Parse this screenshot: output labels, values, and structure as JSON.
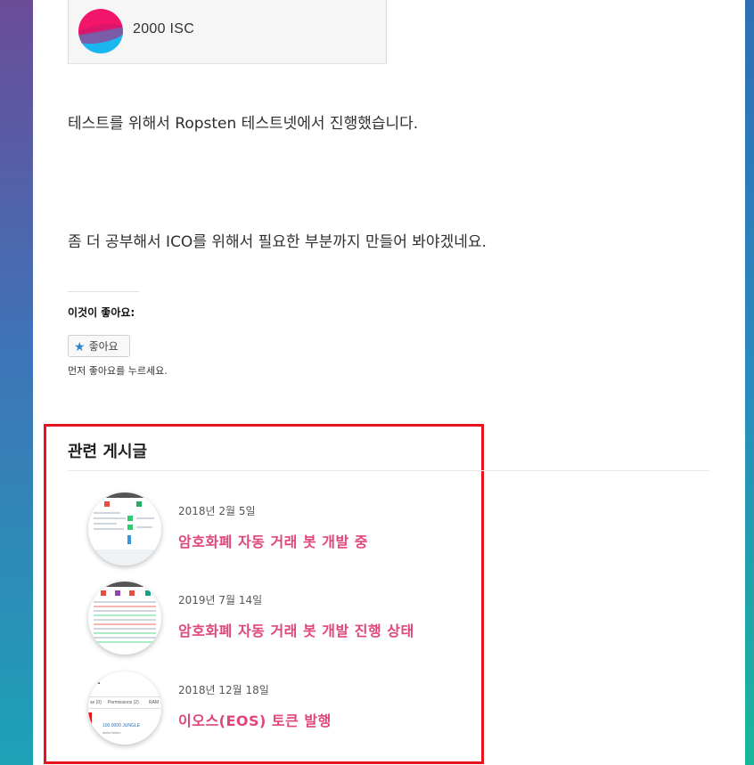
{
  "token": {
    "name": "2000 ISC",
    "icon": "token-logo-icon"
  },
  "article": {
    "paragraph1": "테스트를 위해서 Ropsten 테스트넷에서 진행했습니다.",
    "paragraph2": "좀 더 공부해서 ICO를 위해서 필요한 부분까지 만들어 봐야겠네요."
  },
  "like": {
    "heading": "이것이 좋아요:",
    "button_label": "좋아요",
    "note": "먼저 좋아요를 누르세요."
  },
  "related": {
    "heading": "관련 게시글",
    "posts": [
      {
        "date": "2018년 2월 5일",
        "title": "암호화폐 자동 거래 봇 개발 중"
      },
      {
        "date": "2019년 7월 14일",
        "title": "암호화폐 자동 거래 봇 개발 진행 상태"
      },
      {
        "date": "2018년 12월 18일",
        "title": "이오스(EOS) 토큰 발행"
      }
    ]
  },
  "thumb3_text": {
    "col1": "se (0)",
    "col2": "Permissions (2)",
    "col3": "RAM",
    "amount": "100.0000 JUNGLE",
    "sub": "weird token"
  },
  "colors": {
    "accent": "#e0457b",
    "highlight": "#e6141c",
    "star": "#2a87c9"
  }
}
